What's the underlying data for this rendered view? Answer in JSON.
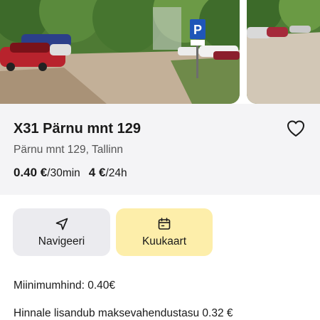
{
  "parking": {
    "title": "X31 Pärnu mnt 129",
    "address": "Pärnu mnt 129, Tallinn",
    "prices": [
      {
        "value": "0.40 €",
        "unit": "/30min"
      },
      {
        "value": "4 €",
        "unit": "/24h"
      }
    ]
  },
  "actions": {
    "navigate_label": "Navigeeri",
    "monthly_card_label": "Kuukaart"
  },
  "details": {
    "min_price": "Miinimumhind: 0.40€",
    "fee_note": "Hinnale lisandub maksevahendustasu 0.32 €"
  },
  "icons": {
    "favorite": "heart-icon",
    "navigate": "navigation-arrow-icon",
    "calendar": "calendar-icon"
  },
  "colors": {
    "card_background": "#f4f4f6",
    "navigate_button": "#ebebef",
    "monthly_card_button": "#fdeeaa",
    "parking_sign": "#1f56b8"
  }
}
